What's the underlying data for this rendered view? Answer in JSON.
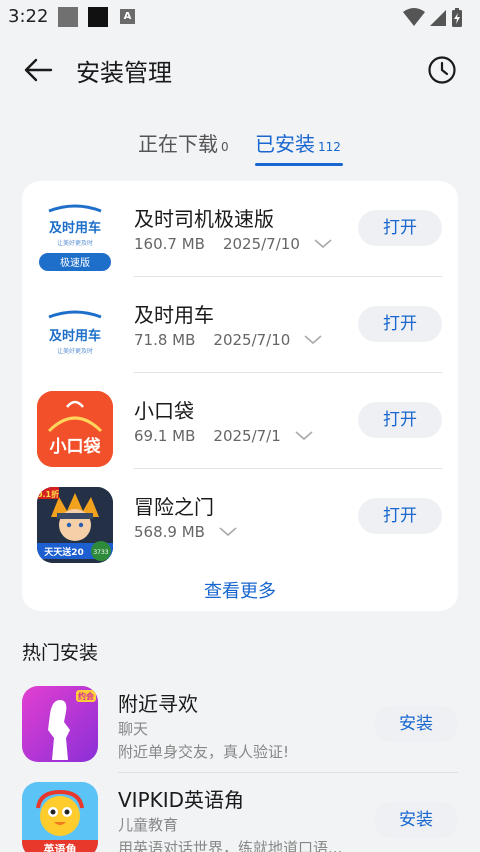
{
  "status_bar": {
    "time": "3:22",
    "a_badge": "A"
  },
  "header": {
    "title": "安装管理"
  },
  "tabs": [
    {
      "label": "正在下载",
      "count": "0"
    },
    {
      "label": "已安装",
      "count": "112"
    }
  ],
  "installed": {
    "apps": [
      {
        "name": "及时司机极速版",
        "size": "160.7 MB",
        "date": "2025/7/10",
        "action": "打开",
        "icon_brand": "及时用车",
        "icon_sub": "让美好更及时",
        "icon_tag": "极速版"
      },
      {
        "name": "及时用车",
        "size": "71.8 MB",
        "date": "2025/7/10",
        "action": "打开",
        "icon_brand": "及时用车",
        "icon_sub": "让美好更及时"
      },
      {
        "name": "小口袋",
        "size": "69.1 MB",
        "date": "2025/7/1",
        "action": "打开",
        "icon_brand": "小口袋"
      },
      {
        "name": "冒险之门",
        "size": "568.9 MB",
        "date": "",
        "action": "打开",
        "icon_badge": "0.1折",
        "icon_banner": "天天送20",
        "icon_corner": "3733"
      }
    ],
    "see_more": "查看更多"
  },
  "hot": {
    "title": "热门安装",
    "apps": [
      {
        "name": "附近寻欢",
        "category": "聊天",
        "desc": "附近单身交友，真人验证!",
        "action": "安装",
        "icon_tag": "约会"
      },
      {
        "name": "VIPKID英语角",
        "category": "儿童教育",
        "desc": "用英语对话世界，练就地道口语...",
        "action": "安装",
        "icon_tag": "英语角"
      }
    ]
  },
  "colors": {
    "accent": "#1867d0",
    "background": "#f1f3f5",
    "card": "#ffffff",
    "button_bg": "#eef0f3"
  }
}
